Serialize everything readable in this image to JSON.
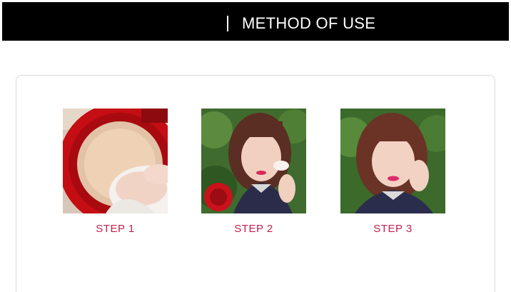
{
  "header": {
    "title": "METHOD OF USE"
  },
  "steps": [
    {
      "label": "STEP 1",
      "image": "cushion-puff-photo"
    },
    {
      "label": "STEP 2",
      "image": "woman-applying-puff-photo"
    },
    {
      "label": "STEP 3",
      "image": "woman-patting-cheek-photo"
    }
  ],
  "colors": {
    "header_bg": "#000000",
    "header_text": "#ffffff",
    "step_label": "#c41e4a",
    "card_border": "#d9d9d9"
  }
}
